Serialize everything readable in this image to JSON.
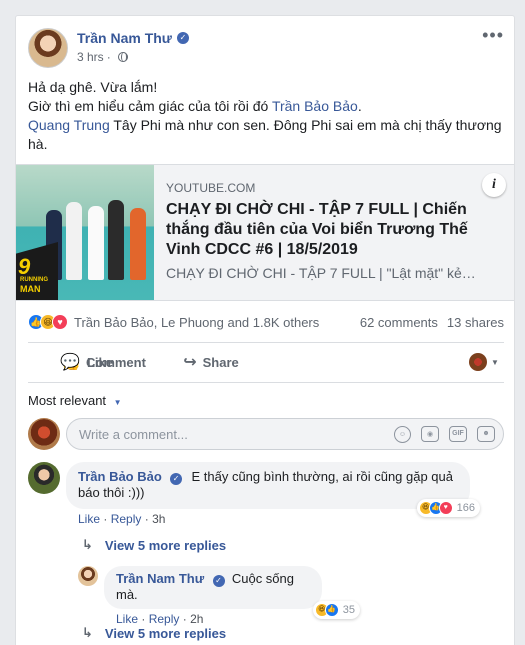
{
  "post": {
    "author": "Trần Nam Thư",
    "time": "3 hrs",
    "line1": "Hả dạ ghê. Vừa lắm!",
    "line2_prefix": "Giờ thì em hiểu cảm giác của tôi rồi đó ",
    "line2_tag": "Trần Bảo Bảo",
    "line2_suffix": ".",
    "line3_tag": "Quang Trung",
    "line3_text": " Tây Phi mà như con sen. Đông Phi sai em mà chị thấy thương hà."
  },
  "preview": {
    "domain": "YOUTUBE.COM",
    "title": "CHẠY ĐI CHỜ CHI - TẬP 7 FULL | Chiến thắng đầu tiên của Voi biển Trương Thế Vinh CDCC #6 | 18/5/2019",
    "description": "CHẠY ĐI CHỜ CHI - TẬP 7 FULL | \"Lật mặt\" kẻ…",
    "thumb_logo_top": "9",
    "thumb_logo_small": "RUNNING",
    "thumb_logo_word": "MAN",
    "info_label": "i"
  },
  "summary": {
    "names": "Trần Bảo Bảo, Le Phuong and 1.8K others",
    "comments": "62 comments",
    "shares": "13 shares"
  },
  "actions": {
    "like": "Like",
    "comment": "Comment",
    "share": "Share"
  },
  "sort_label": "Most relevant",
  "composer": {
    "placeholder": "Write a comment...",
    "gif_label": "GIF"
  },
  "comments": [
    {
      "author": "Trần Bảo Bảo",
      "text": "E thấy cũng bình thường, ai rồi cũng gặp quả báo thôi :)))",
      "like": "Like",
      "reply": "Reply",
      "time": "3h",
      "reactions": "166"
    }
  ],
  "view_more_1": "View 5 more replies",
  "reply": {
    "author": "Trần Nam Thư",
    "text": "Cuộc sống mà.",
    "like": "Like",
    "reply": "Reply",
    "time": "2h",
    "reactions": "35"
  },
  "view_more_2": "View 5 more replies",
  "colors": {
    "link": "#385898",
    "like_blue": "#1877f2",
    "love_red": "#f33e58",
    "haha_yellow": "#f7b928"
  }
}
